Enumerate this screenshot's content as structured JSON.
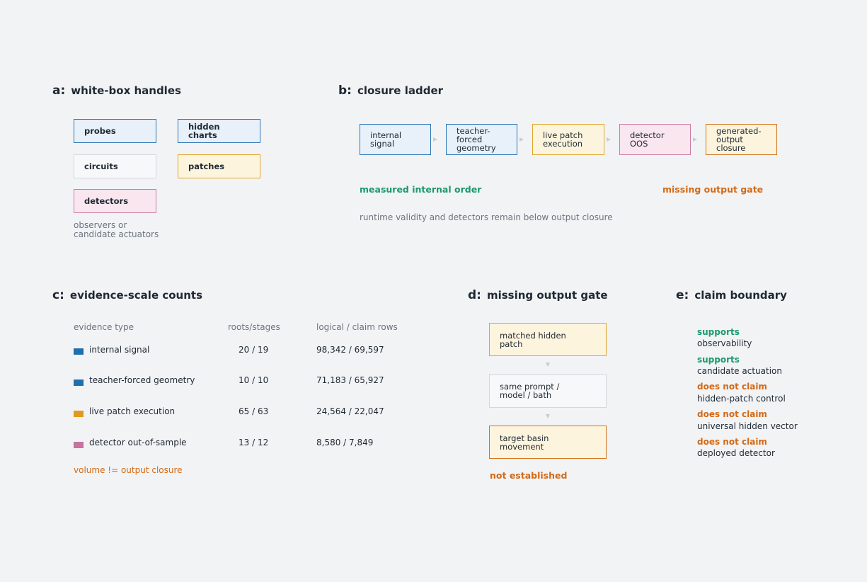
{
  "panel_a": {
    "letter": "a:",
    "title": "white-box handles",
    "boxes": [
      "probes",
      "hidden\ncharts",
      "circuits",
      "patches",
      "detectors"
    ],
    "note": "observers or\ncandidate actuators"
  },
  "panel_b": {
    "letter": "b:",
    "title": "closure ladder",
    "steps": [
      "internal\nsignal",
      "teacher-\nforced\ngeometry",
      "live patch\nexecution",
      "detector\nOOS",
      "generated-\noutput\nclosure"
    ],
    "left_label": "measured internal order",
    "right_label": "missing output gate",
    "note": "runtime validity and detectors remain below output closure"
  },
  "panel_c": {
    "letter": "c:",
    "title": "evidence-scale counts",
    "headers": [
      "evidence type",
      "roots/stages",
      "logical / claim rows"
    ],
    "rows": [
      {
        "type": "internal signal",
        "roots": "20 / 19",
        "rows": "98,342 / 69,597",
        "color": "#1f6fad"
      },
      {
        "type": "teacher-forced geometry",
        "roots": "10 / 10",
        "rows": "71,183 / 65,927",
        "color": "#1f6fad"
      },
      {
        "type": "live patch execution",
        "roots": "65 / 63",
        "rows": "24,564 / 22,047",
        "color": "#e09b1d"
      },
      {
        "type": "detector out-of-sample",
        "roots": "13 / 12",
        "rows": "8,580 / 7,849",
        "color": "#c772a0"
      }
    ],
    "footer": "volume != output closure"
  },
  "panel_d": {
    "letter": "d:",
    "title": "missing output gate",
    "steps": [
      "matched hidden\npatch",
      "same prompt /\nmodel / bath",
      "target basin\nmovement"
    ],
    "status": "not established"
  },
  "panel_e": {
    "letter": "e:",
    "title": "claim boundary",
    "claims": [
      {
        "kind": "supports",
        "text": "observability"
      },
      {
        "kind": "supports",
        "text": "candidate actuation"
      },
      {
        "kind": "does not claim",
        "text": "hidden-patch control"
      },
      {
        "kind": "does not claim",
        "text": "universal hidden vector"
      },
      {
        "kind": "does not claim",
        "text": "deployed detector"
      }
    ]
  },
  "colors": {
    "supports": "#1a9a6b",
    "does_not_claim": "#d36a16"
  }
}
